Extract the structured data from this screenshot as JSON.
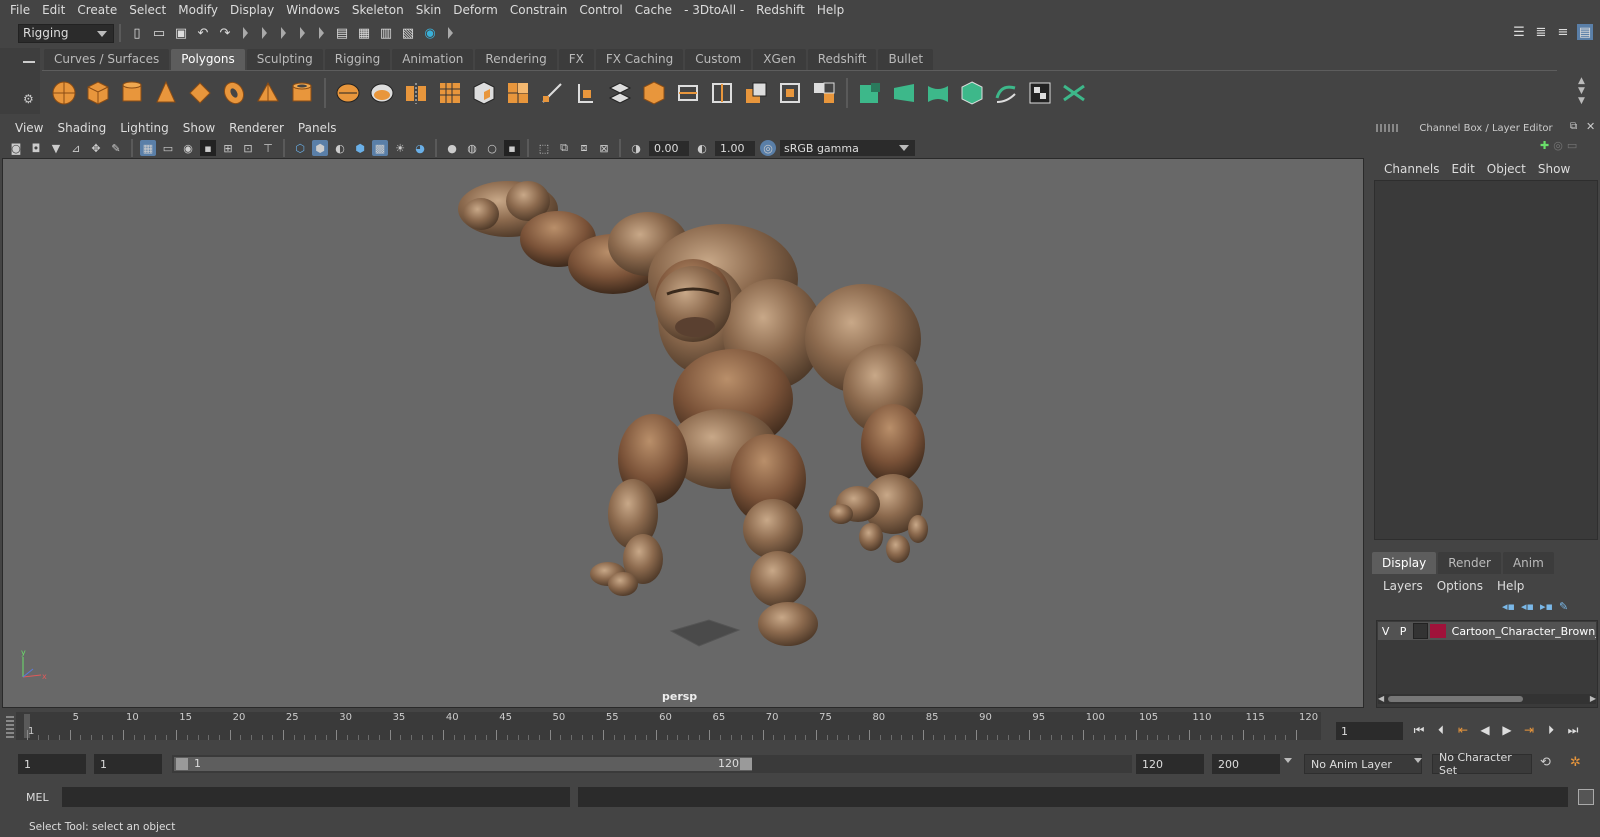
{
  "menu": [
    "File",
    "Edit",
    "Create",
    "Select",
    "Modify",
    "Display",
    "Windows",
    "Skeleton",
    "Skin",
    "Deform",
    "Constrain",
    "Control",
    "Cache",
    "- 3DtoAll -",
    "Redshift",
    "Help"
  ],
  "mode_selector": "Rigging",
  "shelf_tabs": [
    "Curves / Surfaces",
    "Polygons",
    "Sculpting",
    "Rigging",
    "Animation",
    "Rendering",
    "FX",
    "FX Caching",
    "Custom",
    "XGen",
    "Redshift",
    "Bullet"
  ],
  "active_shelf_tab": "Polygons",
  "viewport": {
    "menu": [
      "View",
      "Shading",
      "Lighting",
      "Show",
      "Renderer",
      "Panels"
    ],
    "exposure": "0.00",
    "gamma": "1.00",
    "color_space": "sRGB gamma",
    "camera_label": "persp"
  },
  "right_panel": {
    "title": "Channel Box / Layer Editor",
    "menu": [
      "Channels",
      "Edit",
      "Object",
      "Show"
    ],
    "tabs": [
      "Display",
      "Render",
      "Anim"
    ],
    "active_tab": "Display",
    "layer_menu": [
      "Layers",
      "Options",
      "Help"
    ],
    "layer": {
      "v": "V",
      "p": "P",
      "name": "Cartoon_Character_Brown_S",
      "color": "#a0123a"
    }
  },
  "timeline": {
    "tick_labels": [
      "1",
      "5",
      "10",
      "15",
      "20",
      "25",
      "30",
      "35",
      "40",
      "45",
      "50",
      "55",
      "60",
      "65",
      "70",
      "75",
      "80",
      "85",
      "90",
      "95",
      "100",
      "105",
      "110",
      "115",
      "120"
    ],
    "current_frame": "1"
  },
  "range": {
    "start": "1",
    "playback_start": "1",
    "slider_start": "1",
    "slider_end": "120",
    "playback_end": "120",
    "end": "200",
    "anim_layer": "No Anim Layer",
    "character_set": "No Character Set"
  },
  "command_line": {
    "language": "MEL"
  },
  "status_text": "Select Tool: select an object",
  "colors": {
    "poly_icon": "#e8963c",
    "green_icon": "#3db88a",
    "highlight": "#5a7fa8"
  }
}
